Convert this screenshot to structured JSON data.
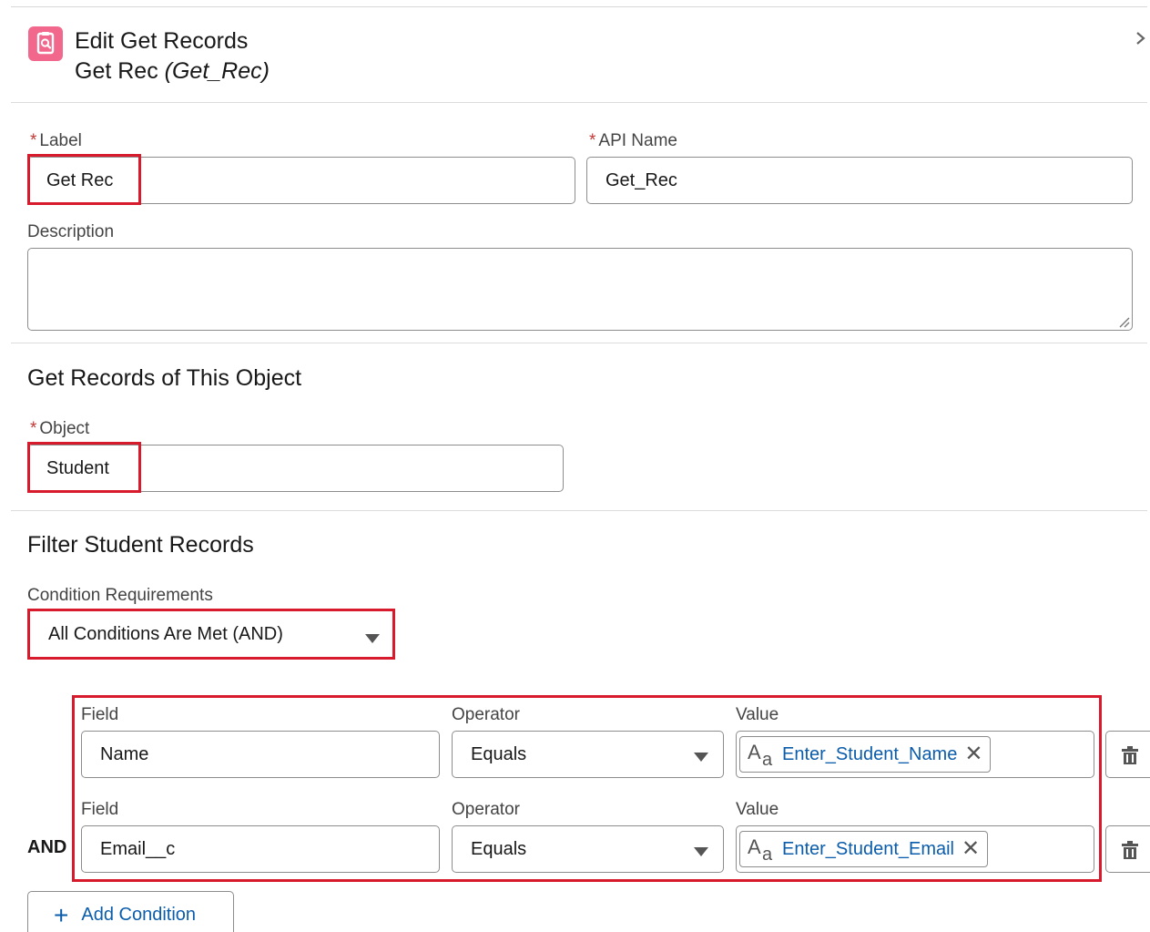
{
  "header": {
    "title": "Edit Get Records",
    "subtitle_name": "Get Rec",
    "subtitle_api": "(Get_Rec)",
    "icon": "get-records-icon",
    "icon_color": "#f2688d"
  },
  "fields": {
    "label_label": "Label",
    "label_value": "Get Rec",
    "api_label": "API Name",
    "api_value": "Get_Rec",
    "description_label": "Description",
    "description_value": ""
  },
  "object_section": {
    "title": "Get Records of This Object",
    "object_label": "Object",
    "object_value": "Student"
  },
  "filter_section": {
    "title": "Filter Student Records",
    "condition_label": "Condition Requirements",
    "condition_value": "All Conditions Are Met (AND)",
    "conditions": [
      {
        "field_label": "Field",
        "field_value": "Name",
        "operator_label": "Operator",
        "operator_value": "Equals",
        "value_label": "Value",
        "value_value": "Enter_Student_Name"
      },
      {
        "field_label": "Field",
        "field_value": "Email__c",
        "operator_label": "Operator",
        "operator_value": "Equals",
        "value_label": "Value",
        "value_value": "Enter_Student_Email"
      }
    ],
    "logic_label": "AND",
    "add_condition": "Add Condition"
  },
  "colors": {
    "highlight": "#d81b2c",
    "link": "#0b5cab",
    "required": "#c23934"
  },
  "required_marker": "*"
}
